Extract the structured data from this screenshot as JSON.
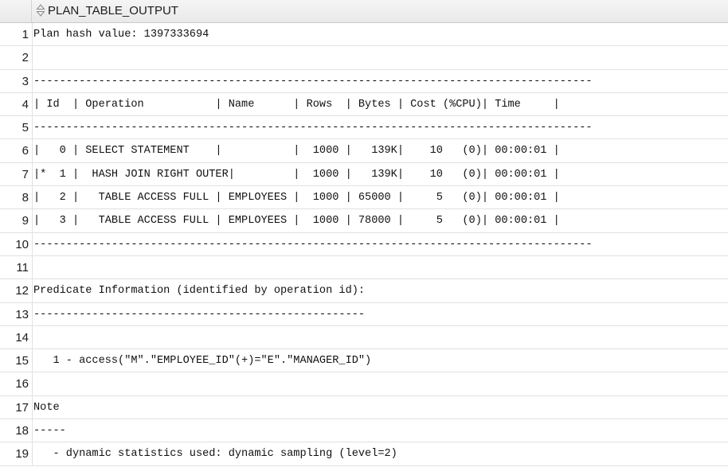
{
  "column_header": {
    "label": "PLAN_TABLE_OUTPUT",
    "icon": "sort-icon"
  },
  "rows": [
    {
      "num": "1",
      "text": "Plan hash value: 1397333694"
    },
    {
      "num": "2",
      "text": ""
    },
    {
      "num": "3",
      "text": "--------------------------------------------------------------------------------------"
    },
    {
      "num": "4",
      "text": "| Id  | Operation           | Name      | Rows  | Bytes | Cost (%CPU)| Time     |"
    },
    {
      "num": "5",
      "text": "--------------------------------------------------------------------------------------"
    },
    {
      "num": "6",
      "text": "|   0 | SELECT STATEMENT    |           |  1000 |   139K|    10   (0)| 00:00:01 |"
    },
    {
      "num": "7",
      "text": "|*  1 |  HASH JOIN RIGHT OUTER|         |  1000 |   139K|    10   (0)| 00:00:01 |"
    },
    {
      "num": "8",
      "text": "|   2 |   TABLE ACCESS FULL | EMPLOYEES |  1000 | 65000 |     5   (0)| 00:00:01 |"
    },
    {
      "num": "9",
      "text": "|   3 |   TABLE ACCESS FULL | EMPLOYEES |  1000 | 78000 |     5   (0)| 00:00:01 |"
    },
    {
      "num": "10",
      "text": "--------------------------------------------------------------------------------------"
    },
    {
      "num": "11",
      "text": ""
    },
    {
      "num": "12",
      "text": "Predicate Information (identified by operation id):"
    },
    {
      "num": "13",
      "text": "---------------------------------------------------"
    },
    {
      "num": "14",
      "text": ""
    },
    {
      "num": "15",
      "text": "   1 - access(\"M\".\"EMPLOYEE_ID\"(+)=\"E\".\"MANAGER_ID\")"
    },
    {
      "num": "16",
      "text": ""
    },
    {
      "num": "17",
      "text": "Note"
    },
    {
      "num": "18",
      "text": "-----"
    },
    {
      "num": "19",
      "text": "   - dynamic statistics used: dynamic sampling (level=2)"
    }
  ]
}
